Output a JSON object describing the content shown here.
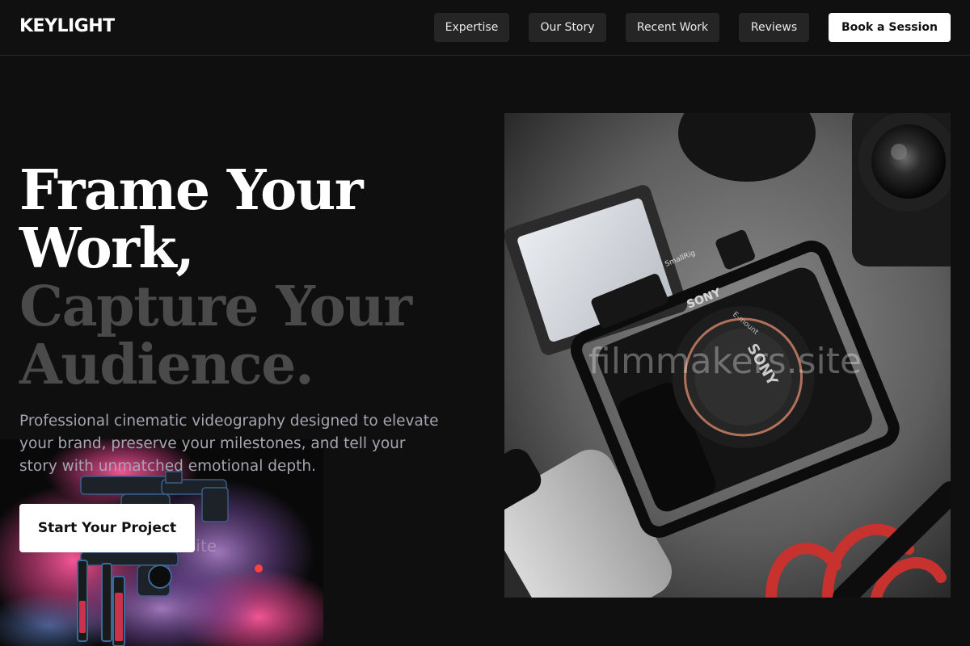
{
  "header": {
    "logo": "KEYLIGHT",
    "nav": [
      "Expertise",
      "Our Story",
      "Recent Work",
      "Reviews"
    ],
    "cta_label": "Book a Session"
  },
  "hero": {
    "title_line1": "Frame Your",
    "title_line2": "Work,",
    "title_line3": "Capture Your",
    "title_line4": "Audience.",
    "subtitle": "Professional cinematic videography designed to elevate your brand, preserve your milestones, and tell your story with unmatched emotional depth.",
    "cta_label": "Start Your Project"
  },
  "images": {
    "camera_watermark": "filmmakers.site",
    "camera_brand": "SONY",
    "cage_brand": "SmallRig",
    "lens_mount_text": "E-mount",
    "faint_mark": "site"
  },
  "colors": {
    "background": "#0f0f0f",
    "nav_button": "#252525",
    "primary_button": "#ffffff",
    "title_muted": "#4a4a4a",
    "subtitle": "#a5a5b1"
  }
}
